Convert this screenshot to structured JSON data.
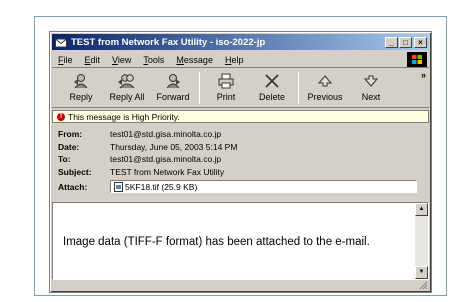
{
  "window": {
    "title": "TEST from Network Fax Utility - iso-2022-jp",
    "controls": [
      "_",
      "□",
      "×"
    ]
  },
  "menu": {
    "items": [
      {
        "label": "File",
        "accel": "F"
      },
      {
        "label": "Edit",
        "accel": "E"
      },
      {
        "label": "View",
        "accel": "V"
      },
      {
        "label": "Tools",
        "accel": "T"
      },
      {
        "label": "Message",
        "accel": "M"
      },
      {
        "label": "Help",
        "accel": "H"
      }
    ]
  },
  "toolbar": {
    "reply": "Reply",
    "reply_all": "Reply All",
    "forward": "Forward",
    "print": "Print",
    "delete": "Delete",
    "previous": "Previous",
    "next": "Next",
    "more": "»"
  },
  "priority": {
    "icon": "!",
    "text": "This message is High Priority."
  },
  "headers": {
    "from_label": "From:",
    "from": "test01@std.gisa.minolta.co.jp",
    "date_label": "Date:",
    "date": "Thursday, June 05, 2003 5:14 PM",
    "to_label": "To:",
    "to": "test01@std.gisa.minolta.co.jp",
    "subject_label": "Subject:",
    "subject": "TEST from Network Fax Utility",
    "attach_label": "Attach:",
    "attachment": "5KF18.tif (25.9 KB)"
  },
  "body": {
    "text": "Image data (TIFF-F format) has been attached to the e-mail."
  },
  "colors": {
    "title_start": "#0a246a",
    "title_end": "#a6caf0",
    "chrome": "#d4d0c8",
    "priority_bg": "#ffffe1"
  }
}
